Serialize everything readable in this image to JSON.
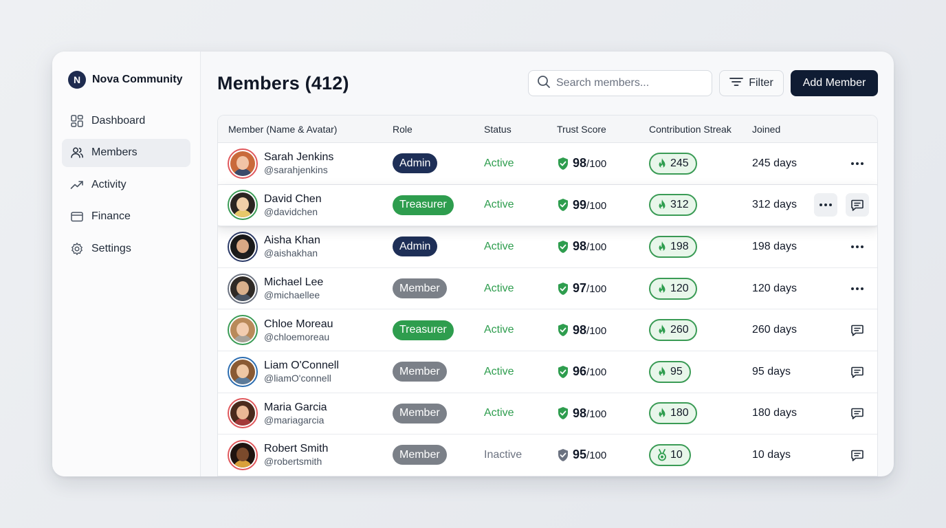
{
  "brand": {
    "name": "Nova Community",
    "logo_letter": "N"
  },
  "sidebar": {
    "items": [
      {
        "label": "Dashboard",
        "icon": "dashboard-icon",
        "active": false
      },
      {
        "label": "Members",
        "icon": "users-icon",
        "active": true
      },
      {
        "label": "Activity",
        "icon": "trending-up-icon",
        "active": false
      },
      {
        "label": "Finance",
        "icon": "wallet-icon",
        "active": false
      },
      {
        "label": "Settings",
        "icon": "gear-icon",
        "active": false
      }
    ]
  },
  "header": {
    "title": "Members (412)",
    "search_placeholder": "Search members...",
    "filter_label": "Filter",
    "add_label": "Add Member"
  },
  "table": {
    "columns": [
      "Member (Name & Avatar)",
      "Role",
      "Status",
      "Trust Score",
      "Contribution Streak",
      "Joined"
    ],
    "trust_max": "/100",
    "rows": [
      {
        "name": "Sarah Jenkins",
        "handle": "@sarahjenkins",
        "role": "Admin",
        "status": "Active",
        "trust": "98",
        "streak": "245",
        "joined": "245 days",
        "actions": [
          "more"
        ],
        "avatar_ring": "#e0575b",
        "skin": "#f2c4a6",
        "hair": "#c96a3b",
        "shirt": "#3b4a6b"
      },
      {
        "name": "David Chen",
        "handle": "@davidchen",
        "role": "Treasurer",
        "status": "Active",
        "trust": "99",
        "streak": "312",
        "joined": "312 days",
        "actions": [
          "more",
          "message"
        ],
        "highlight": true,
        "avatar_ring": "#3a9b55",
        "skin": "#f0cfa8",
        "hair": "#2b2522",
        "shirt": "#e7c86a"
      },
      {
        "name": "Aisha Khan",
        "handle": "@aishakhan",
        "role": "Admin",
        "status": "Active",
        "trust": "98",
        "streak": "198",
        "joined": "198 days",
        "actions": [
          "more"
        ],
        "avatar_ring": "#2b3a67",
        "skin": "#d9a884",
        "hair": "#1a1a1a",
        "shirt": "#1f1f1f"
      },
      {
        "name": "Michael Lee",
        "handle": "@michaellee",
        "role": "Member",
        "status": "Active",
        "trust": "97",
        "streak": "120",
        "joined": "120 days",
        "actions": [
          "more"
        ],
        "avatar_ring": "#6b7280",
        "skin": "#d9b08c",
        "hair": "#2f2a26",
        "shirt": "#4b5563"
      },
      {
        "name": "Chloe Moreau",
        "handle": "@chloemoreau",
        "role": "Treasurer",
        "status": "Active",
        "trust": "98",
        "streak": "260",
        "joined": "260 days",
        "actions": [
          "message"
        ],
        "avatar_ring": "#3a9b55",
        "skin": "#f2cdb0",
        "hair": "#b98a5a",
        "shirt": "#a7a29a"
      },
      {
        "name": "Liam O'Connell",
        "handle": "@liamO'connell",
        "role": "Member",
        "status": "Active",
        "trust": "96",
        "streak": "95",
        "joined": "95 days",
        "actions": [
          "message"
        ],
        "avatar_ring": "#2b6cb0",
        "skin": "#efc7a4",
        "hair": "#8a5a34",
        "shirt": "#5c7a99"
      },
      {
        "name": "Maria Garcia",
        "handle": "@mariagarcia",
        "role": "Member",
        "status": "Active",
        "trust": "98",
        "streak": "180",
        "joined": "180 days",
        "actions": [
          "message"
        ],
        "avatar_ring": "#e0575b",
        "skin": "#e9b896",
        "hair": "#4a2a1c",
        "shirt": "#a33a3a"
      },
      {
        "name": "Robert Smith",
        "handle": "@robertsmith",
        "role": "Member",
        "status": "Inactive",
        "trust": "95",
        "streak": "10",
        "joined": "10 days",
        "actions": [
          "message"
        ],
        "avatar_ring": "#e0575b",
        "skin": "#7a4a2c",
        "hair": "#1f1410",
        "shirt": "#d9a13b"
      }
    ]
  },
  "colors": {
    "admin": "#1e2f57",
    "treasurer": "#2e9d4e",
    "member": "#7b8088",
    "active_text": "#2e9d4e",
    "inactive_text": "#6b7280",
    "shield_active": "#2e9d4e",
    "shield_inactive": "#6b7280",
    "accent": "#0f1c33"
  }
}
